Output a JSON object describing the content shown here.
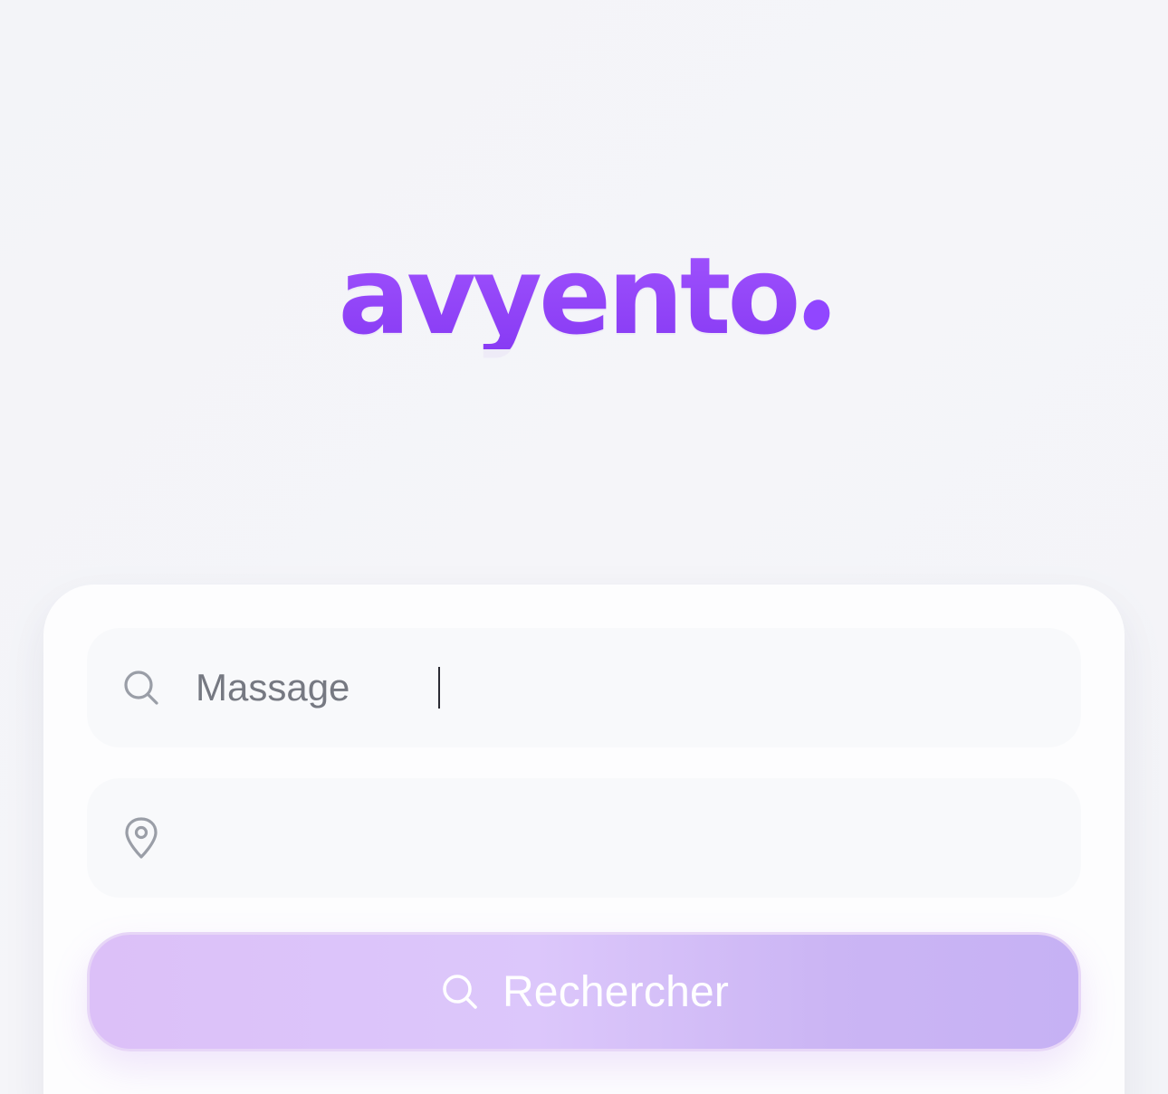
{
  "brand": {
    "name": "avyento",
    "accent_color": "#9146ff"
  },
  "search_card": {
    "query_field": {
      "value": "Massage",
      "icon": "search-icon"
    },
    "location_field": {
      "value": "",
      "icon": "map-pin-icon"
    },
    "submit_button": {
      "label": "Rechercher",
      "icon": "search-icon",
      "color": "#d9c3f8"
    }
  }
}
